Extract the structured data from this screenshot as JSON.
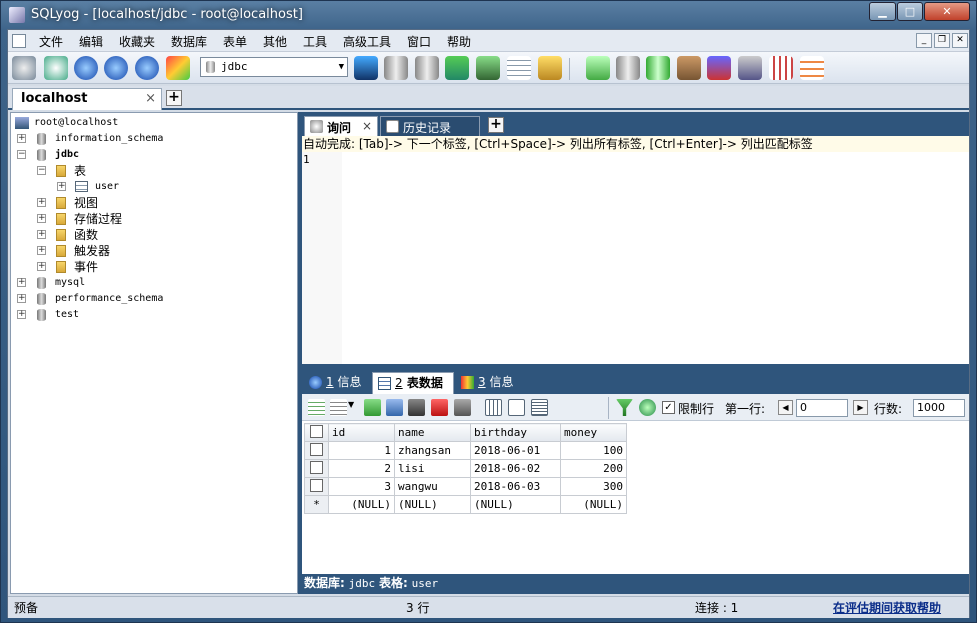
{
  "window": {
    "title": "SQLyog - [localhost/jdbc - root@localhost]"
  },
  "menu": [
    "文件",
    "编辑",
    "收藏夹",
    "数据库",
    "表单",
    "其他",
    "工具",
    "高级工具",
    "窗口",
    "帮助"
  ],
  "toolbar": {
    "db_select": "jdbc"
  },
  "connection_tab": {
    "label": "localhost",
    "close": "×"
  },
  "tree": {
    "root": "root@localhost",
    "items": [
      {
        "label": "information_schema",
        "toggle": "+"
      },
      {
        "label": "jdbc",
        "toggle": "−"
      },
      {
        "label": "表",
        "toggle": "−"
      },
      {
        "label": "user",
        "toggle": "+"
      },
      {
        "label": "视图",
        "toggle": "+"
      },
      {
        "label": "存储过程",
        "toggle": "+"
      },
      {
        "label": "函数",
        "toggle": "+"
      },
      {
        "label": "触发器",
        "toggle": "+"
      },
      {
        "label": "事件",
        "toggle": "+"
      },
      {
        "label": "mysql",
        "toggle": "+"
      },
      {
        "label": "performance_schema",
        "toggle": "+"
      },
      {
        "label": "test",
        "toggle": "+"
      }
    ]
  },
  "editor_tabs": [
    {
      "label": "询问",
      "close": "×"
    },
    {
      "label": "历史记录"
    }
  ],
  "editor": {
    "hint": "自动完成: [Tab]-> 下一个标签, [Ctrl+Space]-> 列出所有标签, [Ctrl+Enter]-> 列出匹配标签",
    "line_number": "1"
  },
  "result_tabs": [
    {
      "num": "1",
      "label": "信息"
    },
    {
      "num": "2",
      "label": "表数据"
    },
    {
      "num": "3",
      "label": "信息"
    }
  ],
  "result_toolbar": {
    "limit_checked": "✓",
    "limit_label": "限制行",
    "first_row_label": "第一行:",
    "first_row_value": "0",
    "rows_label": "行数:",
    "rows_value": "1000"
  },
  "table": {
    "columns": [
      "id",
      "name",
      "birthday",
      "money"
    ],
    "rows": [
      {
        "marker": "",
        "id": "1",
        "name": "zhangsan",
        "birthday": "2018-06-01",
        "money": "100"
      },
      {
        "marker": "",
        "id": "2",
        "name": "lisi",
        "birthday": "2018-06-02",
        "money": "200"
      },
      {
        "marker": "",
        "id": "3",
        "name": "wangwu",
        "birthday": "2018-06-03",
        "money": "300"
      },
      {
        "marker": "*",
        "id": "(NULL)",
        "name": "(NULL)",
        "birthday": "(NULL)",
        "money": "(NULL)"
      }
    ]
  },
  "bottom_info": {
    "db_label": "数据库:",
    "db_value": "jdbc",
    "table_label": "表格:",
    "table_value": "user"
  },
  "statusbar": {
    "left": "预备",
    "rows": "3 行",
    "connections": "连接 : 1",
    "help_link": "在评估期间获取帮助"
  }
}
